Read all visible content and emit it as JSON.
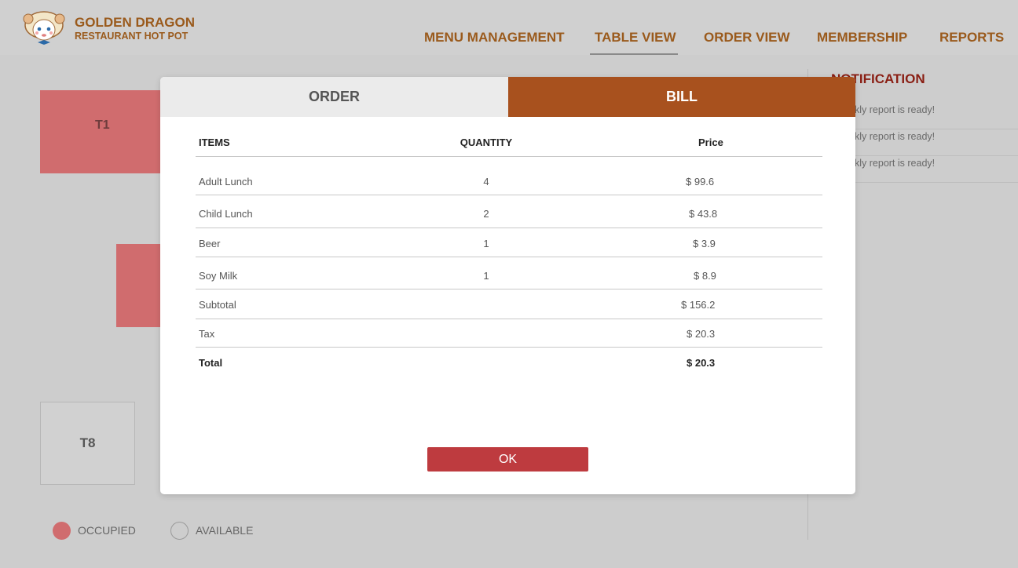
{
  "brand": {
    "name": "GOLDEN DRAGON",
    "subtitle": "RESTAURANT HOT POT"
  },
  "nav": {
    "items": [
      "MENU MANAGEMENT",
      "TABLE VIEW",
      "ORDER VIEW",
      "MEMBERSHIP",
      "REPORTS"
    ],
    "active": "TABLE VIEW"
  },
  "tables": [
    {
      "label": "T1",
      "status": "occupied"
    },
    {
      "label": "",
      "status": "occupied"
    },
    {
      "label": "T8",
      "status": "available"
    }
  ],
  "legend": {
    "occupied": "OCCUPIED",
    "available": "AVAILABLE"
  },
  "notifications": {
    "title": "NOTIFICATION",
    "items": [
      "kly report is ready!",
      "kly report is ready!",
      "kly report is ready!"
    ]
  },
  "modal": {
    "tabs": {
      "order": "ORDER",
      "bill": "BILL"
    },
    "active_tab": "BILL",
    "headers": {
      "items": "ITEMS",
      "quantity": "QUANTITY",
      "price": "Price"
    },
    "rows": [
      {
        "item": "Adult Lunch",
        "qty": "4",
        "price": "$  99.6"
      },
      {
        "item": "Child Lunch",
        "qty": "2",
        "price": "$ 43.8"
      },
      {
        "item": "Beer",
        "qty": "1",
        "price": "$ 3.9"
      },
      {
        "item": "Soy Milk",
        "qty": "1",
        "price": "$ 8.9"
      }
    ],
    "subtotal": {
      "label": "Subtotal",
      "value": "$ 156.2"
    },
    "tax": {
      "label": "Tax",
      "value": "$ 20.3"
    },
    "total": {
      "label": "Total",
      "value": "$ 20.3"
    },
    "ok_label": "OK"
  },
  "colors": {
    "brand": "#9a5a1c",
    "bill_tab": "#a8511e",
    "ok_button": "#be3b3f",
    "occupied": "#d06c6e",
    "notification_title": "#8a1f14"
  }
}
